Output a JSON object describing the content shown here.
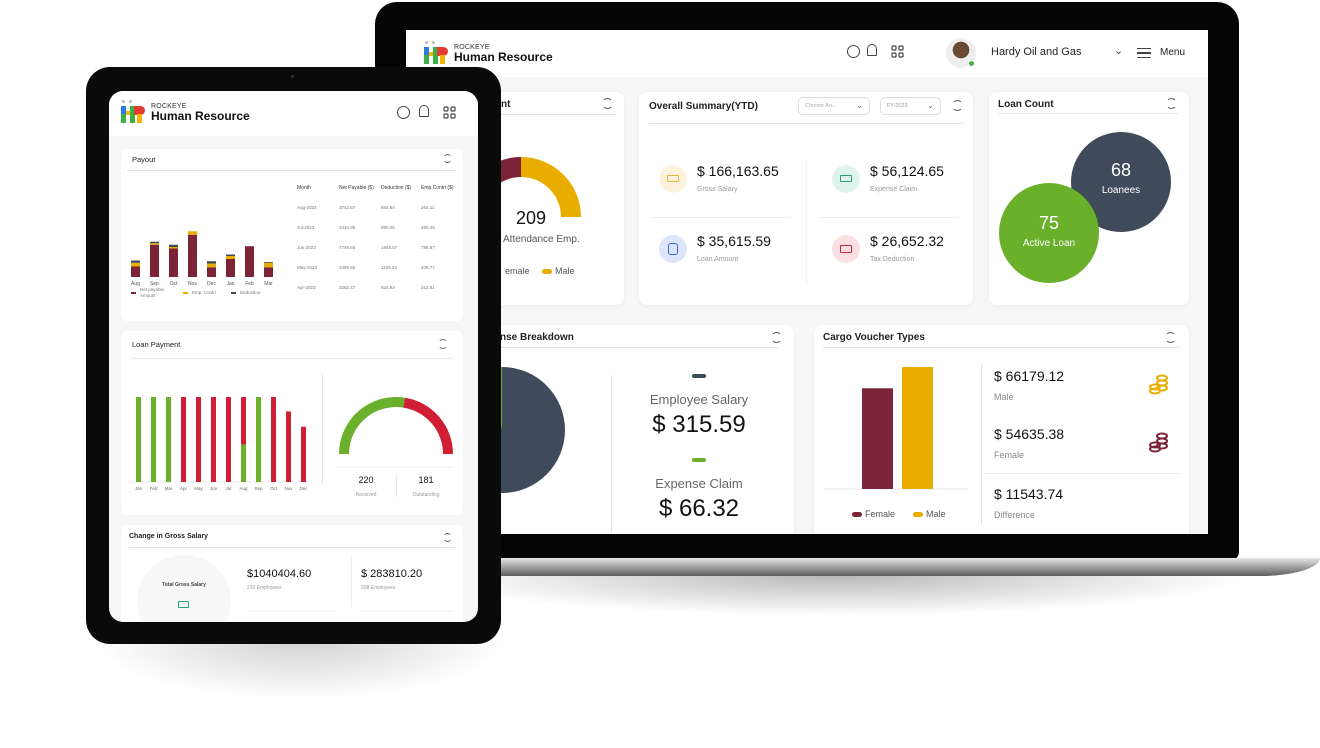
{
  "brand": {
    "small": "ROCKEYE",
    "name": "Human Resource"
  },
  "laptop": {
    "header": {
      "user_name": "Hardy Oil and Gas",
      "menu_label": "Menu",
      "icons": [
        "search-icon",
        "bell-icon",
        "apps-grid-icon",
        "chevron-down-icon",
        "hamburger-icon"
      ]
    },
    "attendance": {
      "title_fragment": "nt",
      "value": "209",
      "label": "Attendance Emp.",
      "legend": [
        {
          "label": "emale",
          "color": "#7b2337"
        },
        {
          "label": "Male",
          "color": "#e9ad00"
        }
      ],
      "female_fraction": 0.3,
      "male_fraction": 0.7
    },
    "summary": {
      "title": "Overall Summary(YTD)",
      "select1_placeholder": "Choose An...",
      "select2_value": "FY-2023",
      "stats": [
        {
          "amount": "$ 166,163.65",
          "label": "Gross Salary",
          "icon": "cash-icon",
          "color": "#e9b23b",
          "bg": "#fdf3dc"
        },
        {
          "amount": "$ 56,124.65",
          "label": "Expense Claim",
          "icon": "cash-icon",
          "color": "#24a37a",
          "bg": "#dff4ec"
        },
        {
          "amount": "$ 35,615.59",
          "label": "Loan Amount",
          "icon": "coins-icon",
          "color": "#3c63e0",
          "bg": "#dde5fb"
        },
        {
          "amount": "$ 26,652.32",
          "label": "Tax Deduction",
          "icon": "cash-icon",
          "color": "#c8243c",
          "bg": "#fbe0e3"
        }
      ]
    },
    "loan_count": {
      "title": "Loan Count",
      "loanees": {
        "value": "68",
        "label": "Loanees",
        "color": "#3f4a5a"
      },
      "active": {
        "value": "75",
        "label": "Active Loan",
        "color": "#6ab02b"
      }
    },
    "expense_breakdown": {
      "title_fragment": "nse Breakdown",
      "items": [
        {
          "label": "Employee Salary",
          "amount": "$ 315.59",
          "color": "#3f4a5a"
        },
        {
          "label": "Expense Claim",
          "amount": "$ 66.32",
          "color": "#6ab02b"
        }
      ]
    },
    "cargo": {
      "title": "Cargo Voucher Types",
      "bars": [
        {
          "name": "Female",
          "value": 54635.38,
          "color": "#7b2337"
        },
        {
          "name": "Male",
          "value": 66179.12,
          "color": "#e9ad00"
        }
      ],
      "legend": [
        {
          "label": "Female",
          "color": "#7b2337"
        },
        {
          "label": "Male",
          "color": "#e9ad00"
        }
      ],
      "stats": [
        {
          "amount": "$ 66179.12",
          "label": "Male",
          "icon": "coins-icon",
          "color": "#e9ad00"
        },
        {
          "amount": "$ 54635.38",
          "label": "Female",
          "icon": "coins-icon",
          "color": "#7b2337"
        },
        {
          "amount": "$ 11543.74",
          "label": "Difference"
        }
      ]
    }
  },
  "tablet": {
    "payout": {
      "title": "Payout",
      "chart": {
        "categories": [
          "Aug",
          "Sep",
          "Oct",
          "Nov",
          "Dec",
          "Jan",
          "Feb",
          "Mar"
        ],
        "series": [
          {
            "name": "Net payable Amount",
            "color": "#7b2337",
            "values": [
              14,
              43,
              38,
              56,
              13,
              24,
              41,
              13
            ]
          },
          {
            "name": "Emp. Contri",
            "color": "#e9ad00",
            "values": [
              5,
              2,
              2,
              5,
              5,
              4,
              0,
              6
            ]
          },
          {
            "name": "Deduction",
            "color": "#3f4a5a",
            "values": [
              3,
              2,
              3,
              0,
              3,
              2,
              0,
              1
            ]
          }
        ],
        "legend": [
          "Net payable Amount",
          "Emp. Contri",
          "Deduction"
        ]
      },
      "table": {
        "headers": [
          "Month",
          "Net Payable ($)",
          "Deduction ($)",
          "Emp.Contri ($)"
        ],
        "rows": [
          [
            "Aug-2023",
            "3742.57",
            "864.64",
            "264.11"
          ],
          [
            "Jul-2023",
            "4434.95",
            "980.06",
            "460.48"
          ],
          [
            "Jun-2023",
            "7746.65",
            "1948.87",
            "796.87"
          ],
          [
            "May-2023",
            "4489.55",
            "1109.24",
            "408.77"
          ],
          [
            "Apr-2023",
            "3262.47",
            "924.93",
            "312.81"
          ]
        ]
      }
    },
    "loan_payment": {
      "title": "Loan Payment",
      "chart": {
        "categories": [
          "Jan",
          "Feb",
          "Mar",
          "Apr",
          "May",
          "Jun",
          "Jul",
          "Aug",
          "Sep",
          "Oct",
          "Nov",
          "Dec"
        ],
        "received": [
          1,
          1,
          1,
          0,
          0,
          0,
          0,
          0.44,
          1,
          0,
          0,
          0
        ],
        "heights": [
          1,
          1,
          1,
          1,
          1,
          1,
          1,
          1,
          1,
          1,
          0.83,
          0.65
        ],
        "received_color": "#6ab02b",
        "outstanding_color": "#d01f34"
      },
      "gauge": {
        "received": "220",
        "received_label": "Received",
        "outstanding": "181",
        "outstanding_label": "Outstanding",
        "received_fraction": 0.55
      }
    },
    "gross_salary": {
      "title": "Change in Gross Salary",
      "total_label": "Total Gross Salary",
      "items": [
        {
          "amount": "$1040404.60",
          "sub": "233 Employees"
        },
        {
          "amount": "$ 283810.20",
          "sub": "208 Employees"
        }
      ]
    }
  }
}
